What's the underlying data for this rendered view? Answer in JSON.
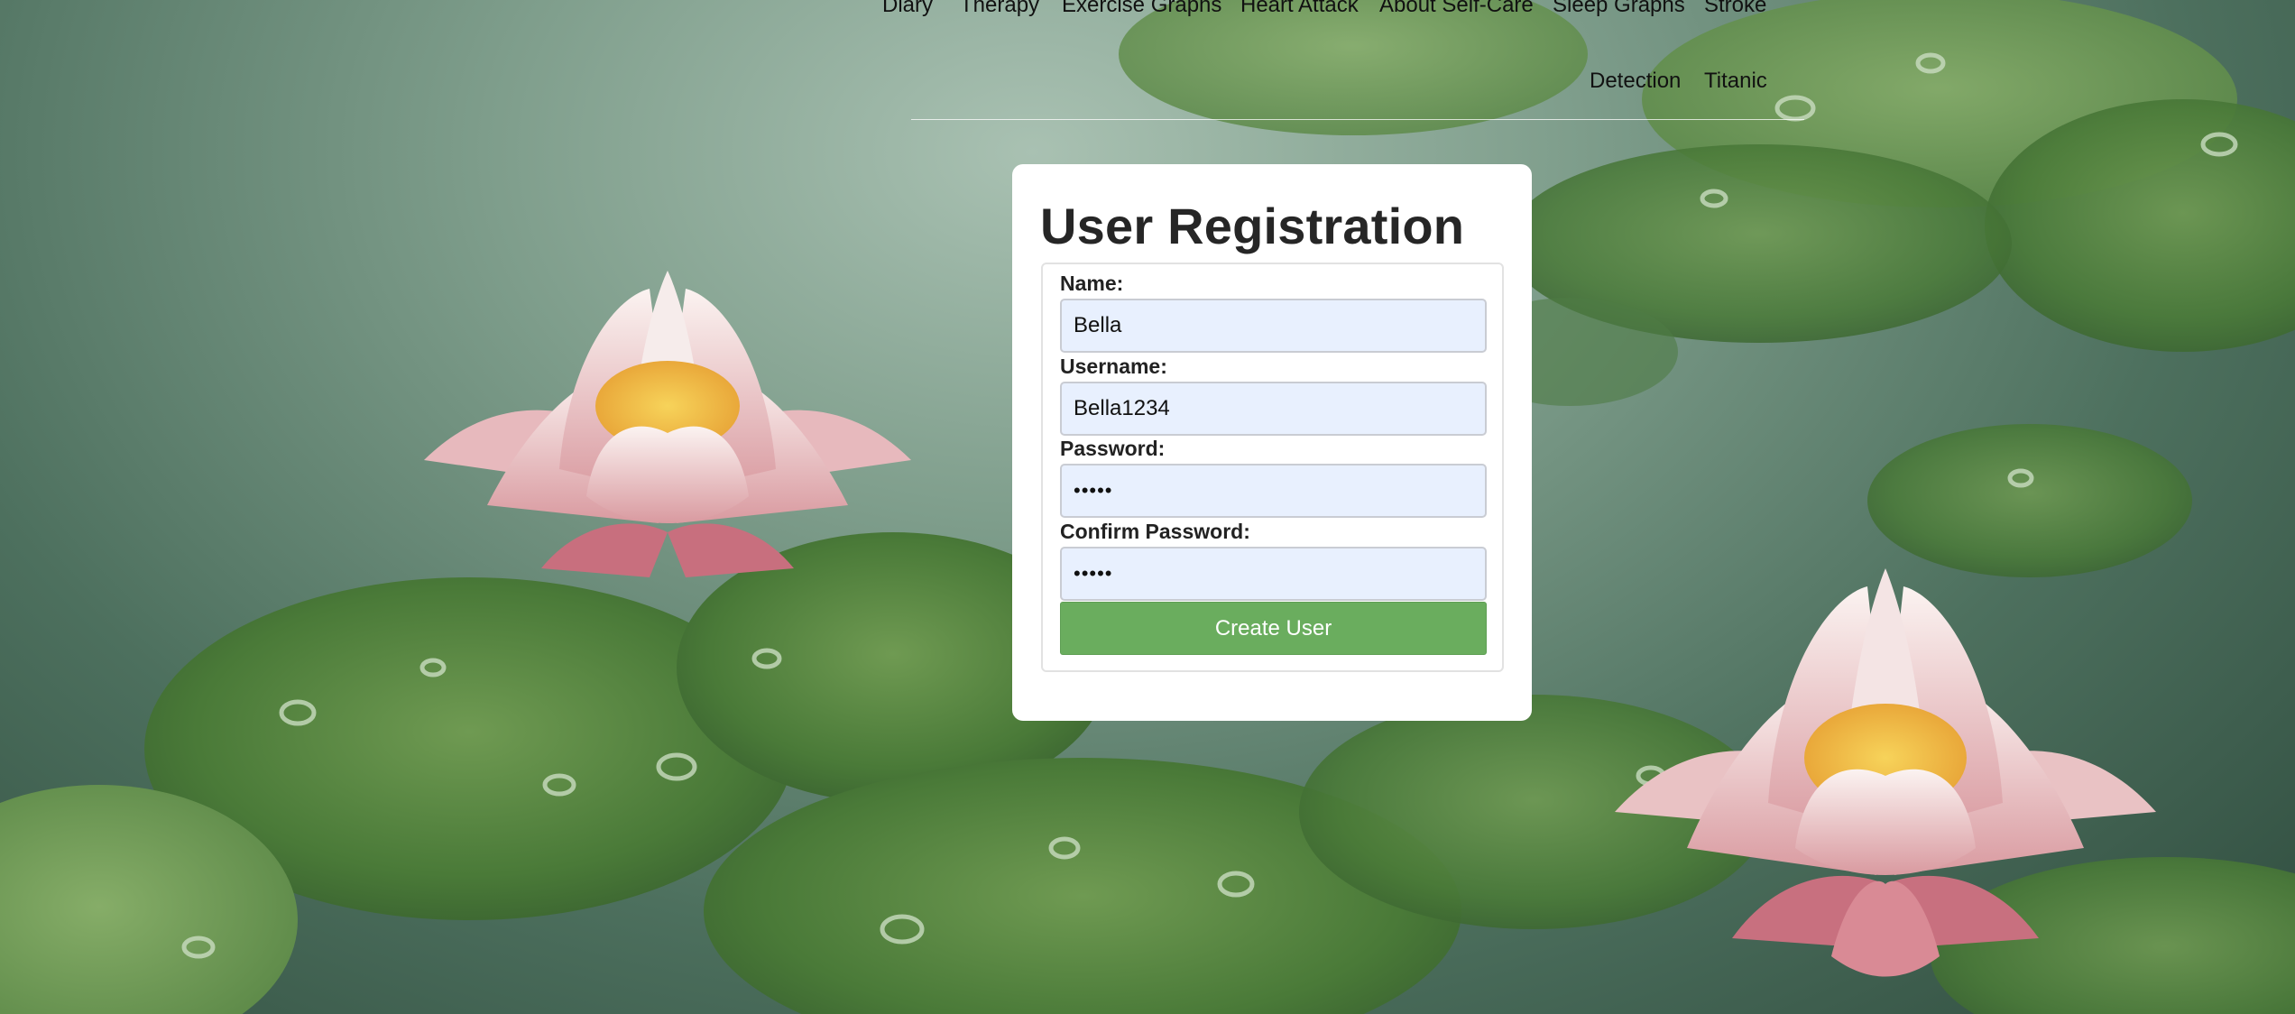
{
  "nav": {
    "items": [
      "Diary",
      "Therapy",
      "Exercise Graphs",
      "Heart Attack",
      "About Self-Care",
      "Sleep Graphs",
      "Stroke",
      "Detection",
      "Titanic"
    ]
  },
  "form": {
    "title": "User Registration",
    "name_label": "Name:",
    "name_value": "Bella",
    "username_label": "Username:",
    "username_value": "Bella1234",
    "password_label": "Password:",
    "password_value": "12345",
    "confirm_label": "Confirm Password:",
    "confirm_value": "12345",
    "submit_label": "Create User"
  },
  "colors": {
    "submit_button": "#6aad5e",
    "input_background": "#e8f0fe",
    "card_background": "#ffffff"
  }
}
